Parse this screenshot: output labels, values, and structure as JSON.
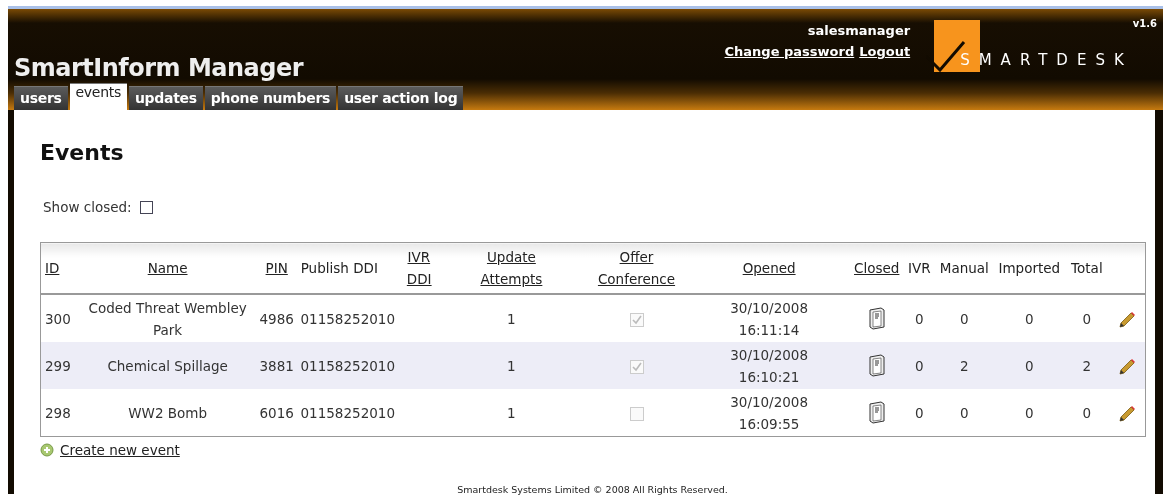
{
  "app": {
    "title": "SmartInform Manager",
    "user": "salesmanager",
    "links": [
      "Change password",
      "Logout"
    ],
    "logo_text": "SMARTDESK",
    "version": "v1.6"
  },
  "tabs": [
    {
      "label": "users",
      "selected": false
    },
    {
      "label": "events",
      "selected": true
    },
    {
      "label": "updates",
      "selected": false
    },
    {
      "label": "phone numbers",
      "selected": false
    },
    {
      "label": "user action log",
      "selected": false
    }
  ],
  "heading": "Events",
  "show_closed": {
    "label": "Show closed:",
    "checked": false
  },
  "table": {
    "columns": [
      {
        "label": "ID",
        "sortable": true
      },
      {
        "label": "Name",
        "sortable": true
      },
      {
        "label": "PIN",
        "sortable": true
      },
      {
        "label": "Publish DDI",
        "sortable": false
      },
      {
        "label": "IVR DDI",
        "sortable": true
      },
      {
        "label": "Update Attempts",
        "sortable": true
      },
      {
        "label": "Offer Conference",
        "sortable": true
      },
      {
        "label": "Opened",
        "sortable": true
      },
      {
        "label": "Closed",
        "sortable": true
      },
      {
        "label": "IVR",
        "sortable": false
      },
      {
        "label": "Manual",
        "sortable": false
      },
      {
        "label": "Imported",
        "sortable": false
      },
      {
        "label": "Total",
        "sortable": false
      }
    ],
    "rows": [
      {
        "id": "300",
        "name": "Coded Threat Wembley Park",
        "pin": "4986",
        "publish_ddi": "01158252010",
        "update_attempts": "1",
        "offer_conference": true,
        "opened_date": "30/10/2008",
        "opened_time": "16:11:14",
        "ivr": "0",
        "manual": "0",
        "imported": "0",
        "total": "0"
      },
      {
        "id": "299",
        "name": "Chemical Spillage",
        "pin": "3881",
        "publish_ddi": "01158252010",
        "update_attempts": "1",
        "offer_conference": true,
        "opened_date": "30/10/2008",
        "opened_time": "16:10:21",
        "ivr": "0",
        "manual": "2",
        "imported": "0",
        "total": "2"
      },
      {
        "id": "298",
        "name": "WW2 Bomb",
        "pin": "6016",
        "publish_ddi": "01158252010",
        "update_attempts": "1",
        "offer_conference": false,
        "opened_date": "30/10/2008",
        "opened_time": "16:09:55",
        "ivr": "0",
        "manual": "0",
        "imported": "0",
        "total": "0"
      }
    ]
  },
  "create_link": "Create new event",
  "footer": "Smartdesk Systems Limited © 2008 All Rights Reserved."
}
